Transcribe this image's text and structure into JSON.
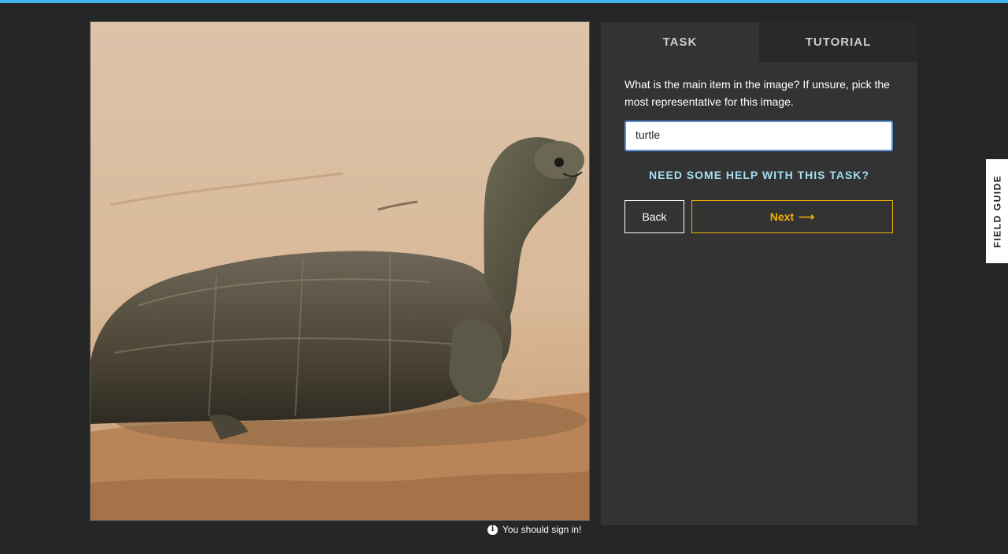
{
  "tabs": [
    {
      "label": "TASK",
      "active": true
    },
    {
      "label": "TUTORIAL",
      "active": false
    }
  ],
  "task": {
    "question": "What is the main item in the image? If unsure, pick the most representative for this image.",
    "answer_value": "turtle",
    "help_link": "NEED SOME HELP WITH THIS TASK?",
    "back_label": "Back",
    "next_label": "Next",
    "next_arrow": "⟶"
  },
  "subject": {
    "icon": "turtle-photo"
  },
  "signin_note": {
    "icon": "info-icon",
    "text": "You should sign in!"
  },
  "field_guide": {
    "label": "FIELD GUIDE"
  },
  "colors": {
    "accent_blue": "#43b4e8",
    "link_cyan": "#a6ddf1",
    "next_gold": "#f0b200",
    "background": "#262626",
    "panel": "#333333"
  }
}
